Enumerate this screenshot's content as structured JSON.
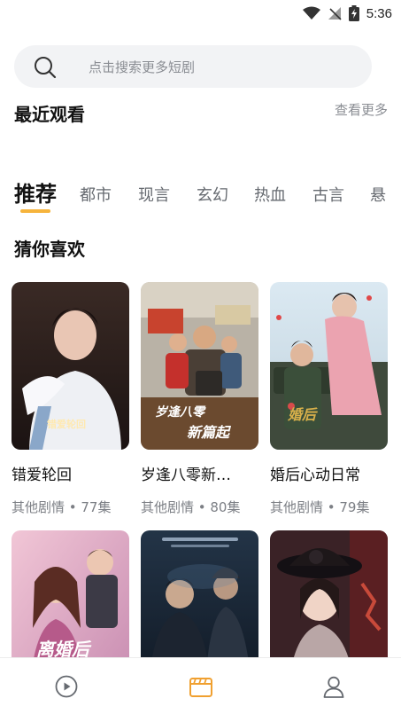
{
  "status_bar": {
    "time": "5:36"
  },
  "search": {
    "placeholder": "点击搜索更多短剧"
  },
  "recent": {
    "title": "最近观看",
    "more_label": "查看更多"
  },
  "tabs": [
    {
      "label": "推荐",
      "active": true
    },
    {
      "label": "都市"
    },
    {
      "label": "现言"
    },
    {
      "label": "玄幻"
    },
    {
      "label": "热血"
    },
    {
      "label": "古言"
    },
    {
      "label": "悬"
    }
  ],
  "section": {
    "title": "猜你喜欢"
  },
  "dramas": [
    {
      "title": "错爱轮回",
      "meta": "其他剧情 • 77集",
      "poster_text": "错爱轮回"
    },
    {
      "title": "岁逢八零新…",
      "meta": "其他剧情 • 80集",
      "poster_text_1": "岁逢八零",
      "poster_text_2": "新篇起"
    },
    {
      "title": "婚后心动日常",
      "meta": "其他剧情 • 79集",
      "poster_text": "婚后"
    },
    {
      "title": "",
      "meta": "",
      "poster_text": "离婚后"
    },
    {
      "title": "",
      "meta": ""
    },
    {
      "title": "",
      "meta": ""
    }
  ],
  "colors": {
    "accent": "#f6b43c",
    "nav_active": "#f0a030",
    "nav_inactive": "#666a70"
  },
  "bottom_nav": [
    {
      "icon": "play-circle-icon",
      "active": false
    },
    {
      "icon": "clapperboard-icon",
      "active": true
    },
    {
      "icon": "user-icon",
      "active": false
    }
  ]
}
